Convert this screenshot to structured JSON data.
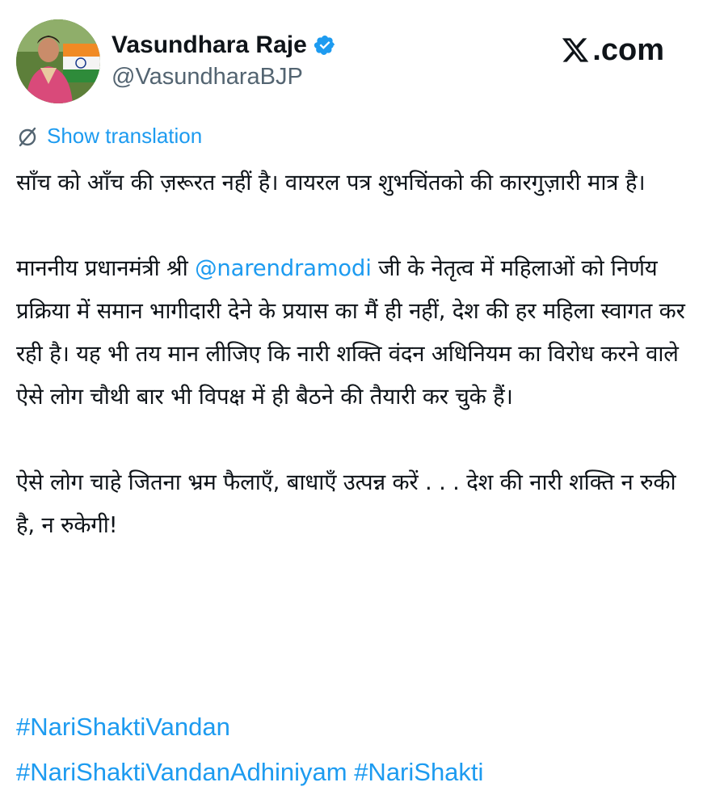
{
  "account": {
    "display_name": "Vasundhara Raje",
    "handle": "@VasundharaBJP",
    "verified_badge_icon": "verified-badge-icon",
    "avatar_icon": "avatar-photo"
  },
  "brand": {
    "icon": "x-logo-icon",
    "label": ".com"
  },
  "translation": {
    "icon": "globe-slash-icon",
    "label": "Show translation"
  },
  "tweet": {
    "para1": "साँच को आँच की ज़रूरत नहीं है। वायरल पत्र शुभचिंतको की कारगुज़ारी मात्र है।",
    "para2_before": "माननीय प्रधानमंत्री श्री ",
    "para2_mention": "@narendramodi",
    "para2_after": " जी के नेतृत्व में महिलाओं को निर्णय प्रक्रिया में समान भागीदारी देने के प्रयास का मैं ही नहीं, देश की हर महिला स्वागत कर रही है। यह भी तय मान लीजिए कि नारी शक्ति वंदन अधिनियम का विरोध करने वाले ऐसे लोग चौथी बार भी विपक्ष में ही बैठने की तैयारी कर चुके हैं।",
    "para3": "ऐसे लोग चाहे जितना भ्रम फैलाएँ, बाधाएँ उत्पन्न करें . . . देश की नारी शक्ति न रुकी है, न रुकेगी!"
  },
  "hashtags": [
    "#NariShaktiVandan",
    "#NariShaktiVandanAdhiniyam",
    "#NariShakti"
  ],
  "colors": {
    "link": "#1d9bf0",
    "text": "#0f1419",
    "secondary": "#536471"
  }
}
